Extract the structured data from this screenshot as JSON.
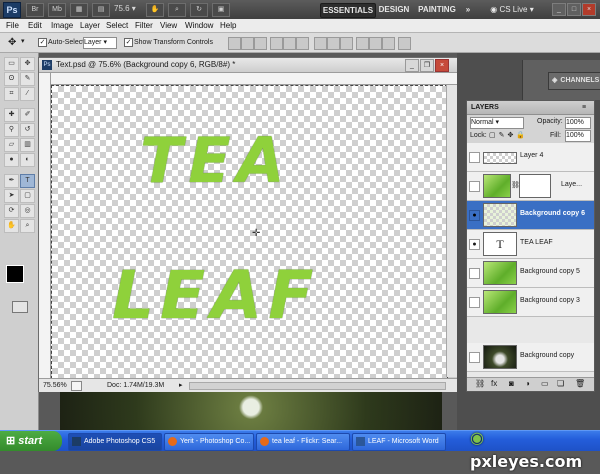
{
  "app_bar": {
    "logo": "Ps",
    "bridge_icon": "Br",
    "mini_icon": "Mb",
    "zoom": "75.6",
    "workspaces": [
      "ESSENTIALS",
      "DESIGN",
      "PAINTING"
    ],
    "more": "»",
    "cs_live": "CS Live"
  },
  "menu": [
    "File",
    "Edit",
    "Image",
    "Layer",
    "Select",
    "Filter",
    "View",
    "Window",
    "Help"
  ],
  "options": {
    "auto_select_label": "Auto-Select:",
    "auto_select_value": "Layer",
    "show_transform_label": "Show Transform Controls"
  },
  "document": {
    "title": "Text.psd @ 75.6% (Background copy 6, RGB/8#) *",
    "line1": "TEA",
    "line2": "LEAF",
    "zoom_status": "75.56%",
    "doc_status": "Doc: 1.74M/19.3M"
  },
  "panels": {
    "channels": "CHANNELS"
  },
  "layers_panel": {
    "title": "LAYERS",
    "blend_mode": "Normal",
    "opacity_label": "Opacity:",
    "opacity_value": "100%",
    "lock_label": "Lock:",
    "fill_label": "Fill:",
    "fill_value": "100%",
    "layers": [
      {
        "name": "Layer 4",
        "thumb": "transparent",
        "visible": false,
        "selected": false
      },
      {
        "name": "Laye...",
        "thumb": "leafy",
        "visible": false,
        "selected": false
      },
      {
        "name": "Background copy 6",
        "thumb": "transparent",
        "visible": true,
        "selected": true
      },
      {
        "name": "TEA LEAF",
        "thumb": "text",
        "visible": true,
        "selected": false
      },
      {
        "name": "Background copy 5",
        "thumb": "leafy",
        "visible": false,
        "selected": false
      },
      {
        "name": "Background copy 3",
        "thumb": "leafy",
        "visible": false,
        "selected": false
      },
      {
        "name": "Background copy",
        "thumb": "photo",
        "visible": false,
        "selected": false
      }
    ]
  },
  "taskbar": {
    "start": "start",
    "tasks": [
      {
        "label": "Adobe Photoshop CS5",
        "active": true
      },
      {
        "label": "Yerit - Photoshop Co...",
        "active": false
      },
      {
        "label": "tea leaf - Flickr: Sear...",
        "active": false
      },
      {
        "label": "LEAF - Microsoft Word",
        "active": false
      }
    ]
  },
  "watermark": "pxleyes.com",
  "colors": {
    "leaf_green": "#8fd13b",
    "selection_blue": "#3a6fc4",
    "taskbar_blue": "#245edb"
  }
}
